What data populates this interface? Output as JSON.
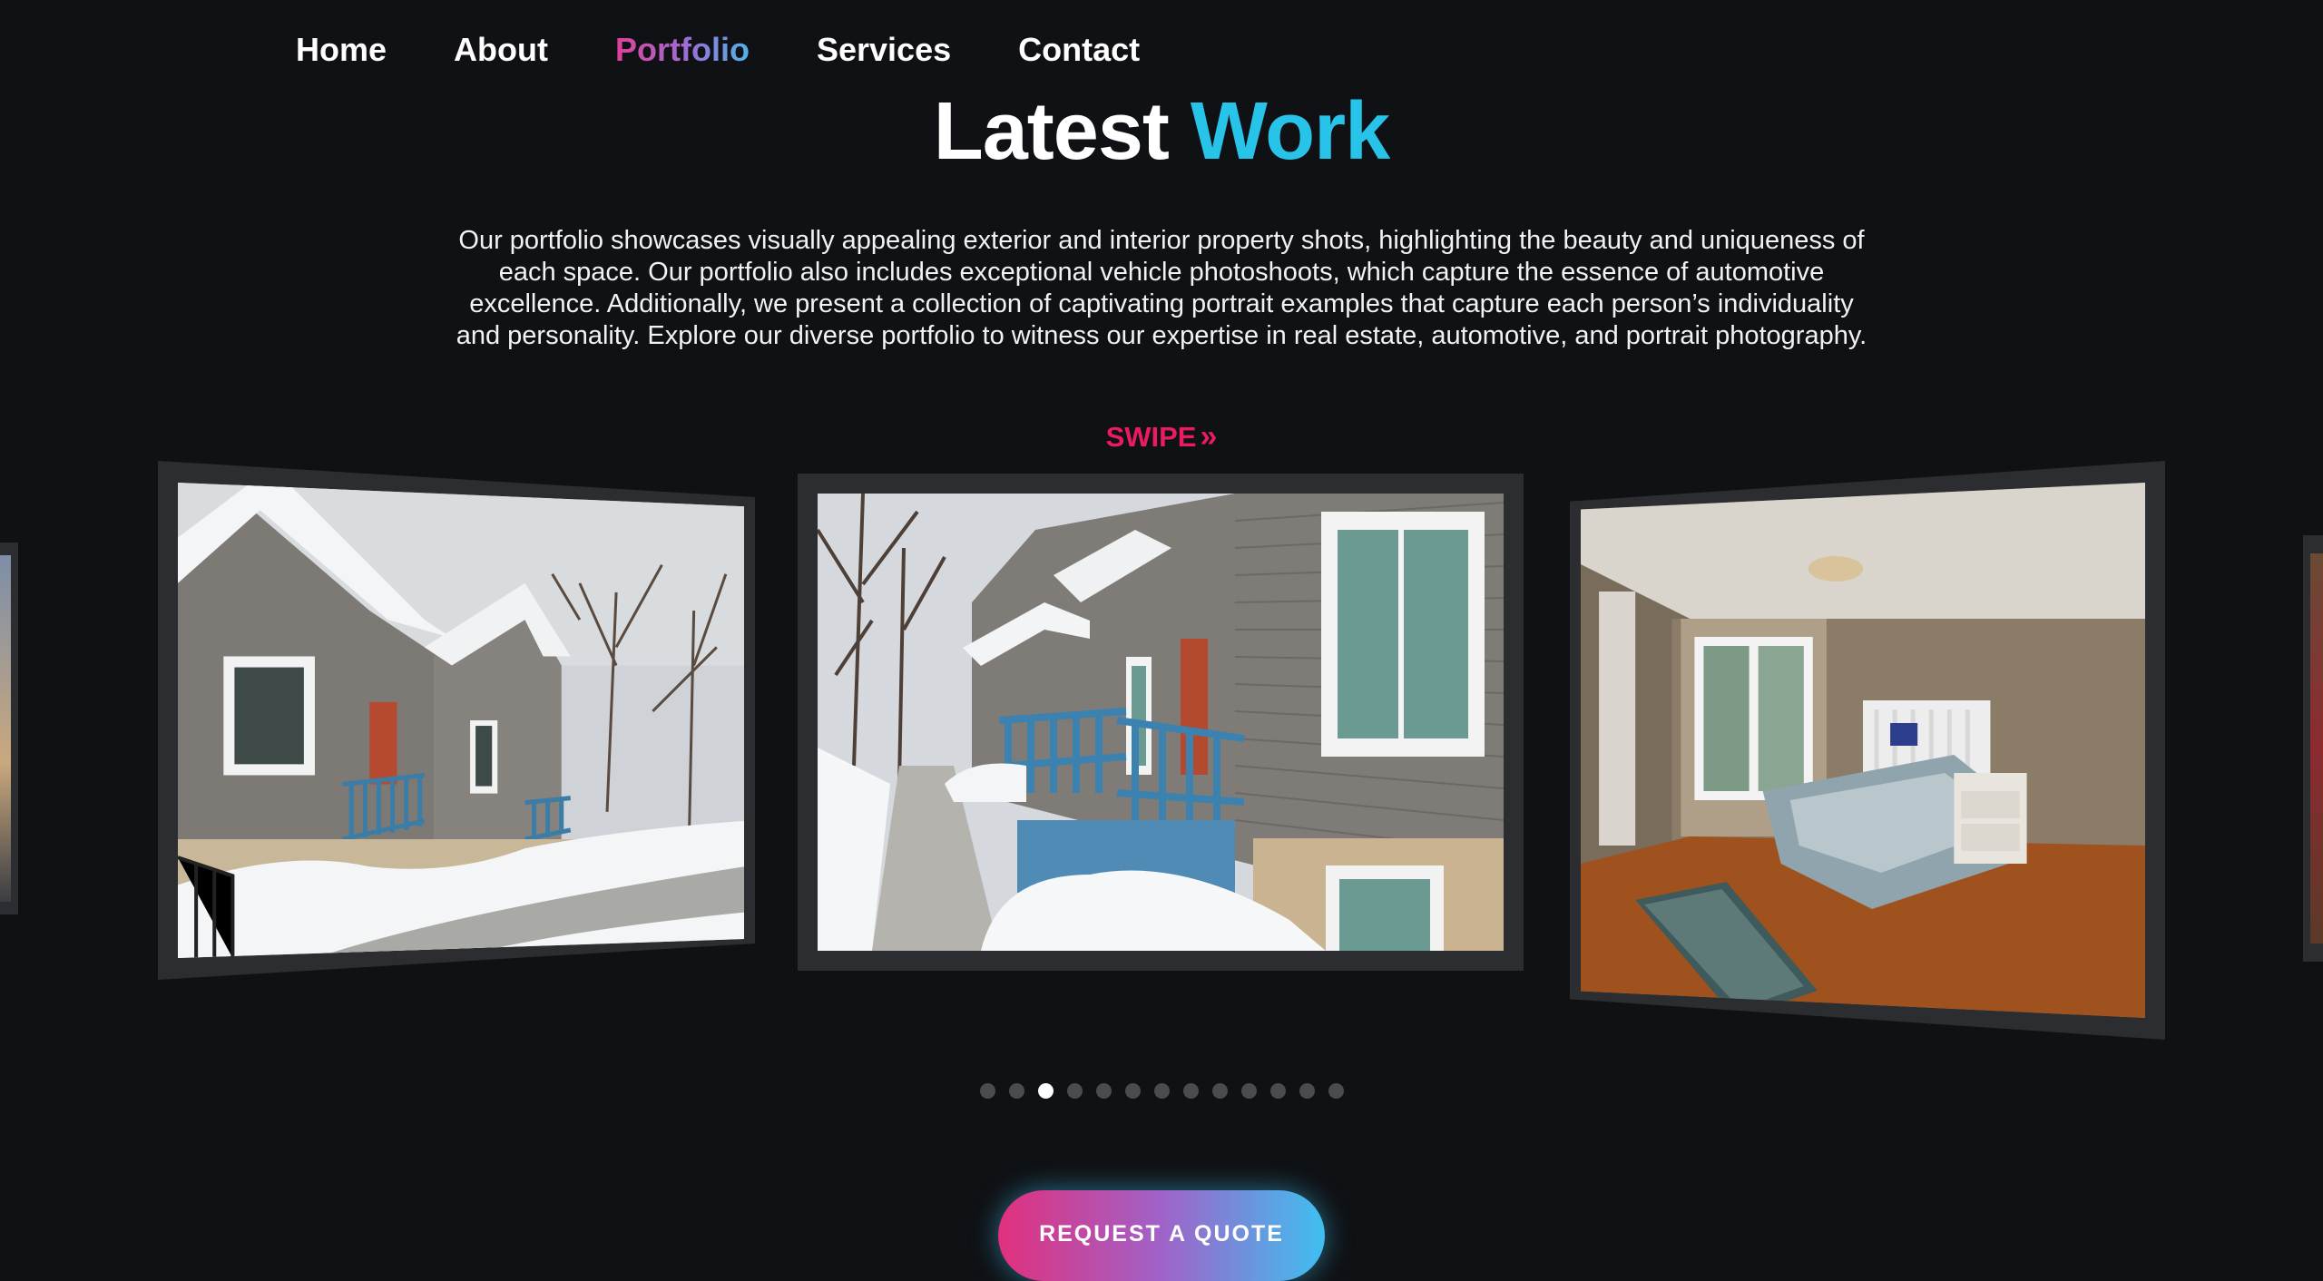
{
  "nav": {
    "items": [
      {
        "label": "Home",
        "active": false
      },
      {
        "label": "About",
        "active": false
      },
      {
        "label": "Portfolio",
        "active": true
      },
      {
        "label": "Services",
        "active": false
      },
      {
        "label": "Contact",
        "active": false
      }
    ]
  },
  "heading": {
    "word1": "Latest",
    "word2": "Work"
  },
  "intro": "Our portfolio showcases visually appealing exterior and interior property shots, highlighting the beauty and uniqueness of each space. Our portfolio also includes exceptional vehicle photoshoots, which capture the essence of automotive excellence. Additionally, we present a collection of captivating portrait examples that capture each person’s individuality and personality. Explore our diverse portfolio to witness our expertise in real estate, automotive, and portrait photography.",
  "swipe": {
    "label": "SWIPE",
    "icon": "double-chevron-right-icon"
  },
  "carousel": {
    "slides": [
      {
        "subject": "snowy townhouse exterior with blue porch railing"
      },
      {
        "subject": "snowy townhouse row with blue steps and sidewalk"
      },
      {
        "subject": "bedroom interior with white bed and hardwood floor"
      }
    ],
    "dot_count": 13,
    "active_dot": 3
  },
  "cta": {
    "label": "REQUEST A QUOTE"
  },
  "colors": {
    "background": "#0f1114",
    "accent_cyan": "#28c3e8",
    "swipe_pink": "#ea1b63",
    "frame": "#2b2d30"
  }
}
